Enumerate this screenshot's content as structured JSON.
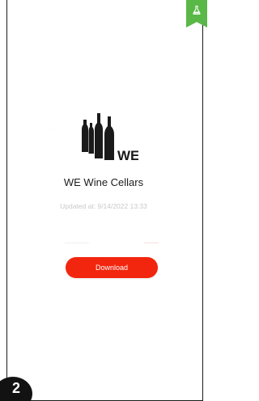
{
  "app": {
    "name": "WE Wine Cellars",
    "logo_text": "WE",
    "updated": "Updated at: 9/14/2022 13:33"
  },
  "actions": {
    "download_label": "Download"
  },
  "badges": {
    "top_right_icon": "flask-icon",
    "corner_text": "2"
  },
  "colors": {
    "accent": "#f2260e",
    "lab_green": "#59b847",
    "logo_black": "#1a1a1a"
  }
}
